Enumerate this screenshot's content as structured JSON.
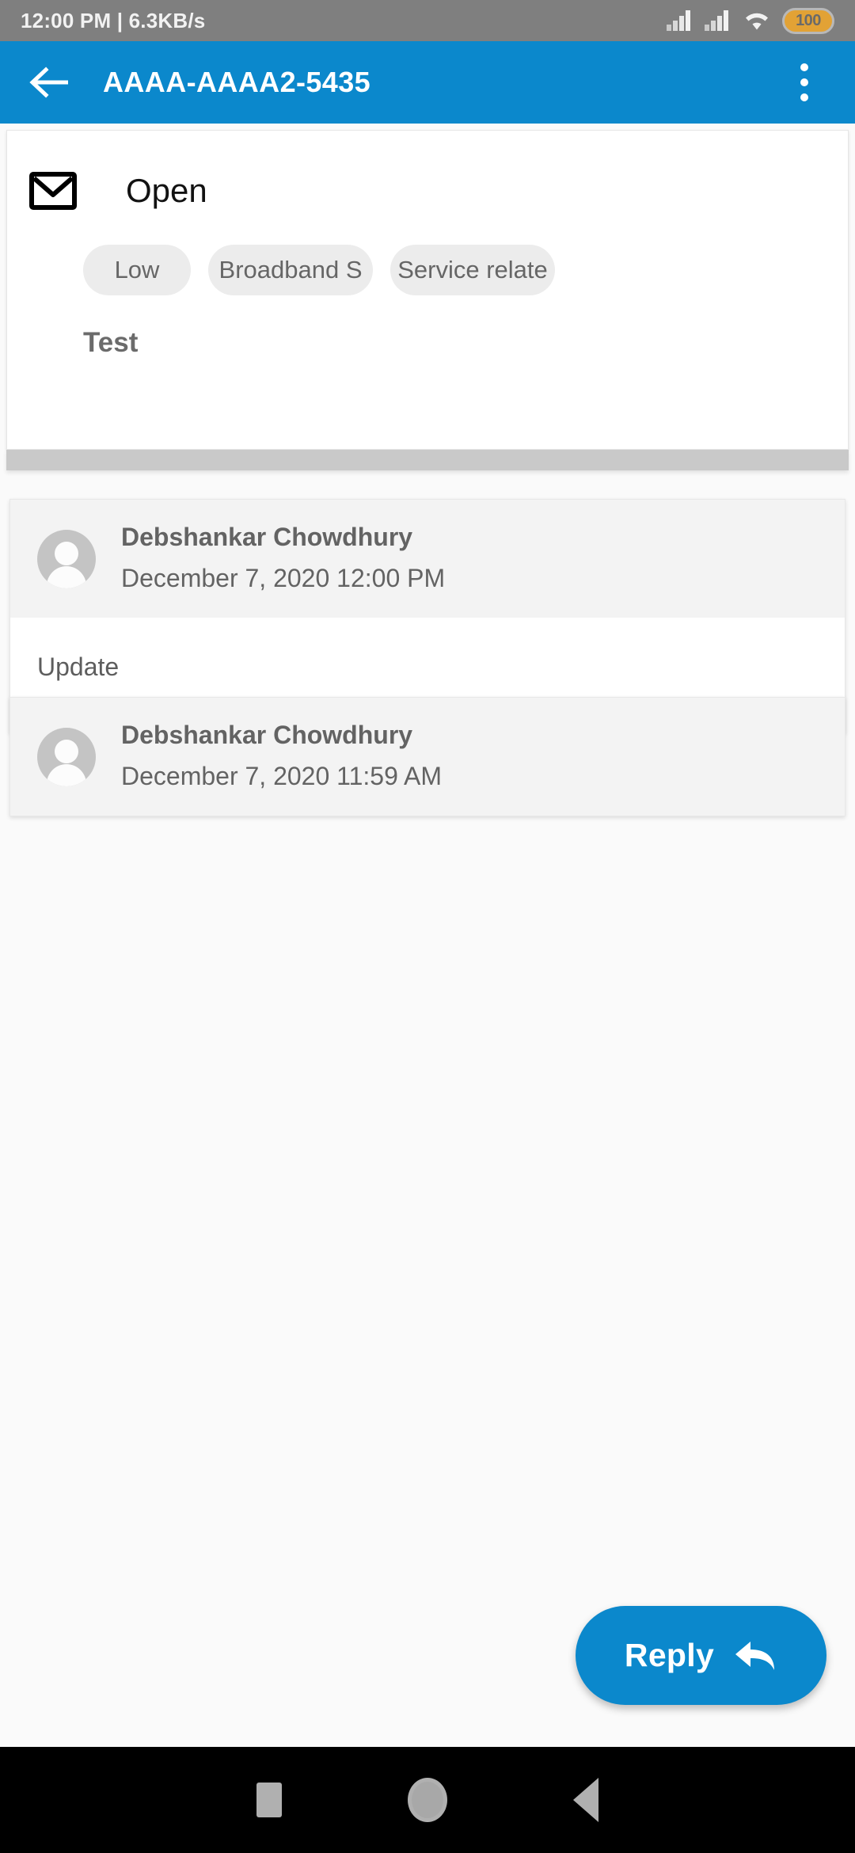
{
  "statusbar": {
    "left_text": "12:00 PM | 6.3KB/s",
    "battery_level": "100",
    "icons": [
      "signal-icon",
      "signal-icon",
      "wifi-icon",
      "battery-icon"
    ]
  },
  "appbar": {
    "back_icon": "arrow-left-icon",
    "title": "AAAA-AAAA2-5435",
    "overflow_icon": "more-vertical-icon",
    "background_color": "#0b88cc"
  },
  "ticket": {
    "status_icon": "envelope-icon",
    "status_label": "Open",
    "chips": [
      {
        "label": "Low"
      },
      {
        "label": "Broadband S"
      },
      {
        "label": "Service relate"
      }
    ],
    "subject": "Test"
  },
  "conversations": [
    {
      "avatar_icon": "person-avatar-icon",
      "author": "Debshankar Chowdhury",
      "timestamp": "December 7, 2020 12:00 PM",
      "body": "Update"
    },
    {
      "avatar_icon": "person-avatar-icon",
      "author": "Debshankar Chowdhury",
      "timestamp": "December 7, 2020 11:59 AM",
      "body": ""
    }
  ],
  "fab": {
    "label": "Reply",
    "icon": "reply-arrow-icon",
    "color": "#0b88cc"
  },
  "navbar": {
    "recents_icon": "square-icon",
    "home_icon": "circle-icon",
    "back_icon": "triangle-left-icon"
  }
}
